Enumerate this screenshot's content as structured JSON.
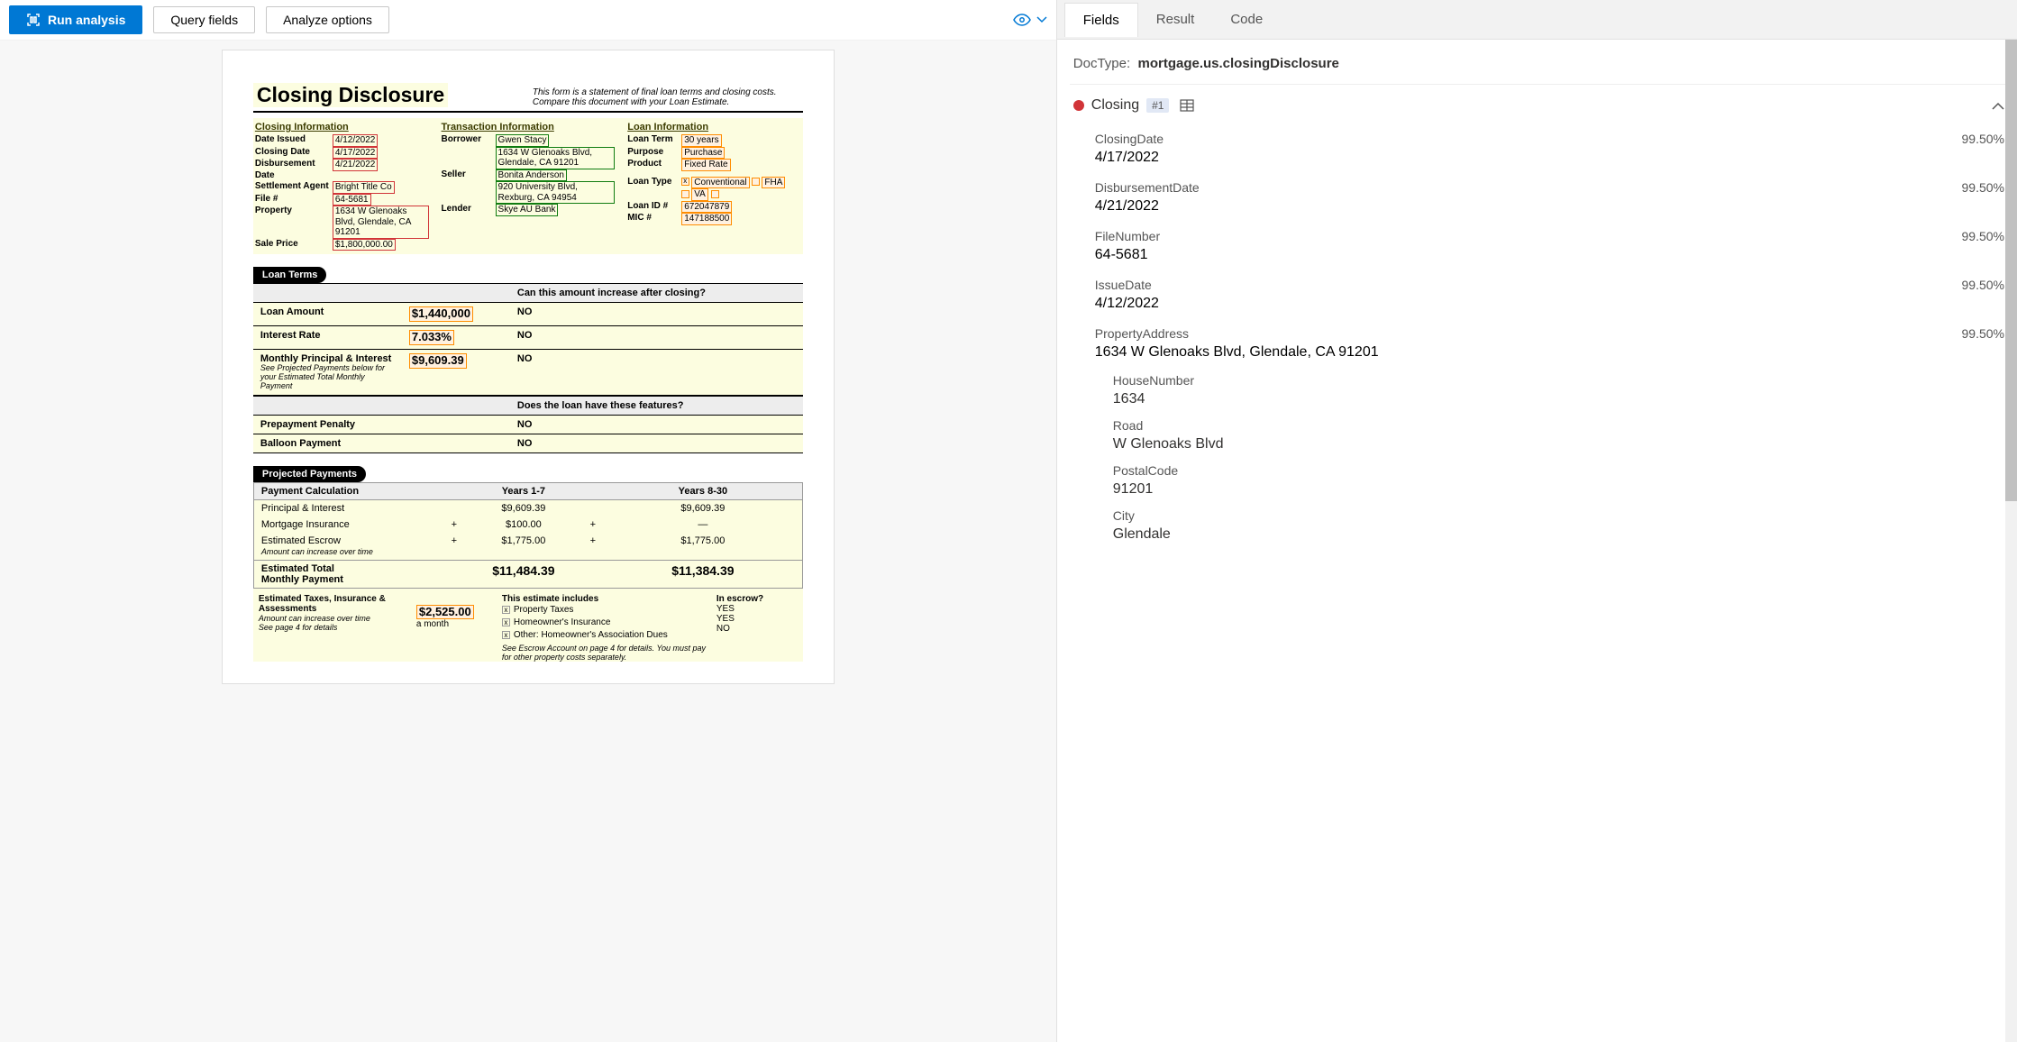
{
  "toolbar": {
    "run": "Run analysis",
    "query": "Query fields",
    "analyze": "Analyze options"
  },
  "document": {
    "title": "Closing Disclosure",
    "subtitle": "This form is a statement of final loan terms and closing costs. Compare this document with your Loan Estimate.",
    "closing_info_title": "Closing Information",
    "transaction_info_title": "Transaction Information",
    "loan_info_title": "Loan Information",
    "closing": {
      "date_issued_l": "Date Issued",
      "date_issued": "4/12/2022",
      "closing_date_l": "Closing Date",
      "closing_date": "4/17/2022",
      "disb_date_l": "Disbursement Date",
      "disb_date": "4/21/2022",
      "settlement_l": "Settlement Agent",
      "settlement": "Bright Title Co",
      "file_l": "File #",
      "file": "64-5681",
      "property_l": "Property",
      "property": "1634 W Glenoaks Blvd, Glendale, CA 91201",
      "sale_l": "Sale Price",
      "sale": "$1,800,000.00"
    },
    "transaction": {
      "borrower_l": "Borrower",
      "borrower_name": "Gwen Stacy",
      "borrower_addr": "1634 W Glenoaks Blvd, Glendale, CA 91201",
      "seller_l": "Seller",
      "seller_name": "Bonita Anderson",
      "seller_addr": "920 University Blvd, Rexburg, CA 94954",
      "lender_l": "Lender",
      "lender": "Skye AU Bank"
    },
    "loan": {
      "term_l": "Loan Term",
      "term": "30 years",
      "purpose_l": "Purpose",
      "purpose": "Purchase",
      "product_l": "Product",
      "product": "Fixed Rate",
      "type_l": "Loan Type",
      "type_conv": "Conventional",
      "type_fha": "FHA",
      "type_va": "VA",
      "id_l": "Loan ID #",
      "id": "672047879",
      "mic_l": "MIC #",
      "mic": "147188500"
    },
    "loan_terms_title": "Loan Terms",
    "lt_header_q": "Can this amount increase after closing?",
    "lt_amount_l": "Loan Amount",
    "lt_amount": "$1,440,000",
    "lt_amount_a": "NO",
    "lt_rate_l": "Interest Rate",
    "lt_rate": "7.033%",
    "lt_rate_a": "NO",
    "lt_pi_l": "Monthly Principal & Interest",
    "lt_pi": "$9,609.39",
    "lt_pi_a": "NO",
    "lt_pi_note": "See Projected Payments below for your Estimated Total Monthly Payment",
    "lt_features_q": "Does the loan have these features?",
    "lt_prepay_l": "Prepayment Penalty",
    "lt_prepay_a": "NO",
    "lt_balloon_l": "Balloon Payment",
    "lt_balloon_a": "NO",
    "pp_title": "Projected Payments",
    "pp_calc": "Payment Calculation",
    "pp_y17": "Years 1-7",
    "pp_y830": "Years 8-30",
    "pp_pi": "Principal & Interest",
    "pp_pi1": "$9,609.39",
    "pp_pi2": "$9,609.39",
    "pp_mi": "Mortgage Insurance",
    "pp_mi1": "$100.00",
    "pp_mi2": "—",
    "pp_esc": "Estimated Escrow",
    "pp_esc_note": "Amount can increase over time",
    "pp_esc1": "$1,775.00",
    "pp_esc2": "$1,775.00",
    "pp_total": "Estimated Total\nMonthly Payment",
    "pp_total1": "$11,484.39",
    "pp_total2": "$11,384.39",
    "tx_l1": "Estimated Taxes, Insurance & Assessments",
    "tx_amt": "$2,525.00",
    "tx_amt_per": "a month",
    "tx_note1": "Amount can increase over time",
    "tx_note2": "See page 4 for details",
    "tx_includes": "This estimate includes",
    "tx_escrow": "In escrow?",
    "tx_r1": "Property Taxes",
    "tx_r1e": "YES",
    "tx_r2": "Homeowner's Insurance",
    "tx_r2e": "YES",
    "tx_r3": "Other: Homeowner's Association Dues",
    "tx_r3e": "NO",
    "tx_foot": "See Escrow Account on page 4 for details. You must pay for other property costs separately."
  },
  "tabs": {
    "fields": "Fields",
    "result": "Result",
    "code": "Code"
  },
  "doctype_label": "DocType:",
  "doctype_value": "mortgage.us.closingDisclosure",
  "group": {
    "name": "Closing",
    "badge": "#1"
  },
  "fields": [
    {
      "label": "ClosingDate",
      "value": "4/17/2022",
      "conf": "99.50%"
    },
    {
      "label": "DisbursementDate",
      "value": "4/21/2022",
      "conf": "99.50%"
    },
    {
      "label": "FileNumber",
      "value": "64-5681",
      "conf": "99.50%"
    },
    {
      "label": "IssueDate",
      "value": "4/12/2022",
      "conf": "99.50%"
    },
    {
      "label": "PropertyAddress",
      "value": "1634 W Glenoaks Blvd, Glendale, CA 91201",
      "conf": "99.50%"
    }
  ],
  "subfields": [
    {
      "label": "HouseNumber",
      "value": "1634"
    },
    {
      "label": "Road",
      "value": "W Glenoaks Blvd"
    },
    {
      "label": "PostalCode",
      "value": "91201"
    },
    {
      "label": "City",
      "value": "Glendale"
    }
  ]
}
